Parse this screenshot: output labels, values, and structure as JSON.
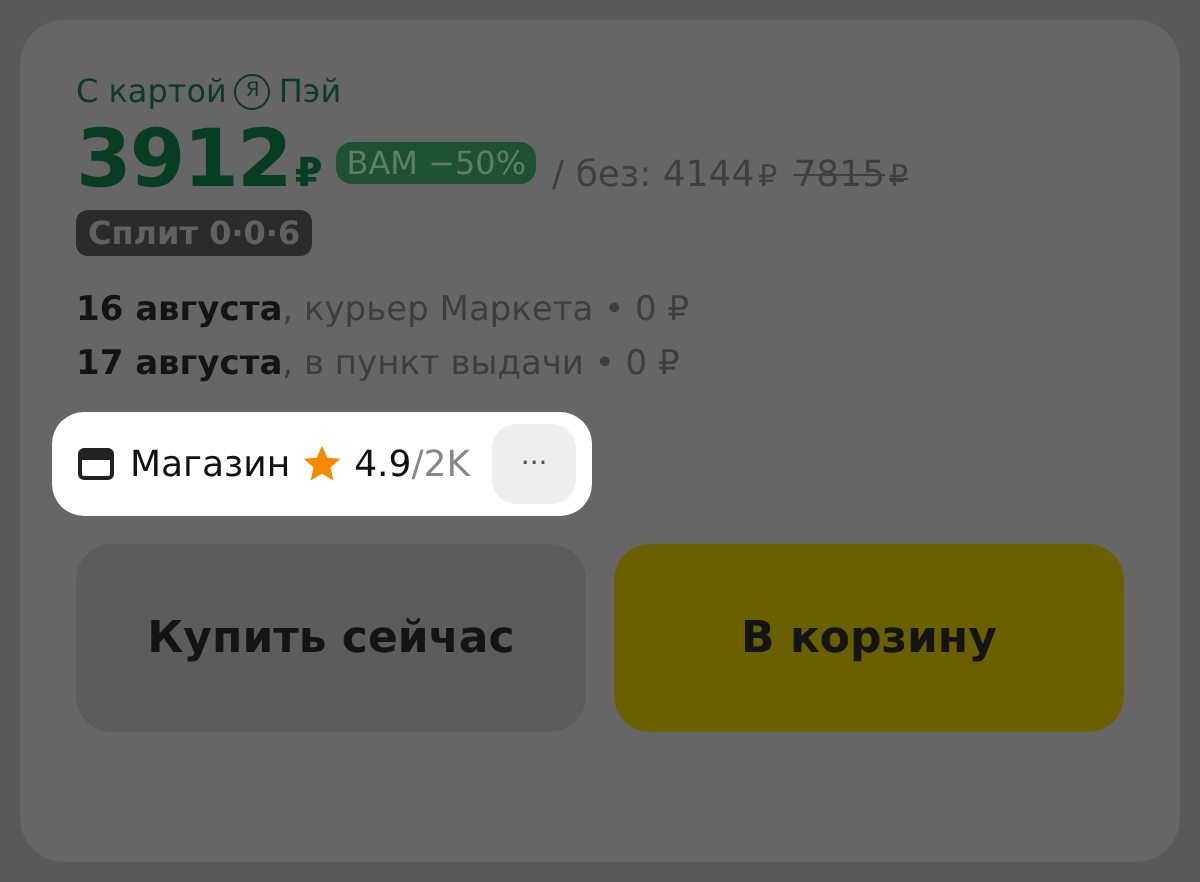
{
  "payment": {
    "prefix": "С картой",
    "logo": "Я",
    "suffix": "Пэй"
  },
  "price": {
    "value": "3912",
    "currency": "₽",
    "discount_badge": "ВАМ −50%",
    "without_label": "/ без:",
    "without_value": "4144",
    "without_currency": "₽",
    "old_value": "7815",
    "old_currency": "₽"
  },
  "installment_badge": "Сплит 0·0·6",
  "delivery": [
    "**16 августа**, курьер Маркета • 0 ₽",
    "**17 августа**, в пункт выдачи • 0 ₽"
  ],
  "shop": {
    "label": "Магазин",
    "rating": "4.9",
    "reviews": "/2K",
    "more": "···"
  },
  "buttons": [
    {
      "label": "Купить сейчас",
      "kind": "secondary"
    },
    {
      "label": "В корзину",
      "kind": "primary"
    }
  ]
}
